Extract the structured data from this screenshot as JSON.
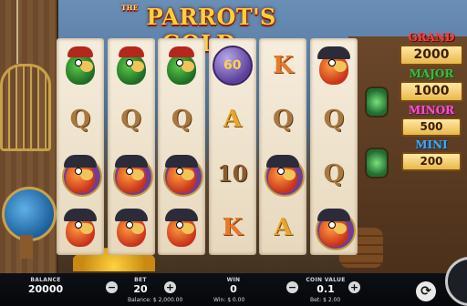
{
  "game": {
    "title": "PARROT'S GOLD",
    "title_prefix": "THE"
  },
  "reels": [
    [
      "parrot-green",
      "Q",
      "parrot-purple",
      "parrot-red"
    ],
    [
      "parrot-green",
      "Q",
      "parrot-purple",
      "parrot-red"
    ],
    [
      "parrot-green",
      "Q",
      "parrot-purple",
      "parrot-red"
    ],
    [
      "60",
      "A",
      "10",
      "K"
    ],
    [
      "K",
      "Q",
      "parrot-purple",
      "A"
    ],
    [
      "parrot-red",
      "Q",
      "Q",
      "parrot-purple"
    ]
  ],
  "jackpots": [
    {
      "name": "GRAND",
      "value": "2000",
      "color": "#ff3d3d"
    },
    {
      "name": "MAJOR",
      "value": "1000",
      "color": "#3dbb3d"
    },
    {
      "name": "MINOR",
      "value": "500",
      "color": "#ff4fd1"
    },
    {
      "name": "MINI",
      "value": "200",
      "color": "#3ba8ff"
    }
  ],
  "bottom_bar": {
    "balance_label": "BALANCE",
    "balance_value": "20000",
    "bet_label": "BET",
    "bet_value": "20",
    "bet_minus": "−",
    "bet_plus": "+",
    "balance_sub": "Balance: $ 2,000.00",
    "win_label": "WIN",
    "win_value": "0",
    "win_sub": "Win: $ 0.00",
    "coin_label": "COIN VALUE",
    "coin_value": "0.1",
    "coin_minus": "−",
    "coin_plus": "+",
    "bet_sub": "Bet: $ 2.00",
    "autoplay_icon": "autoplay-icon",
    "spin_icon": "spin-icon"
  }
}
